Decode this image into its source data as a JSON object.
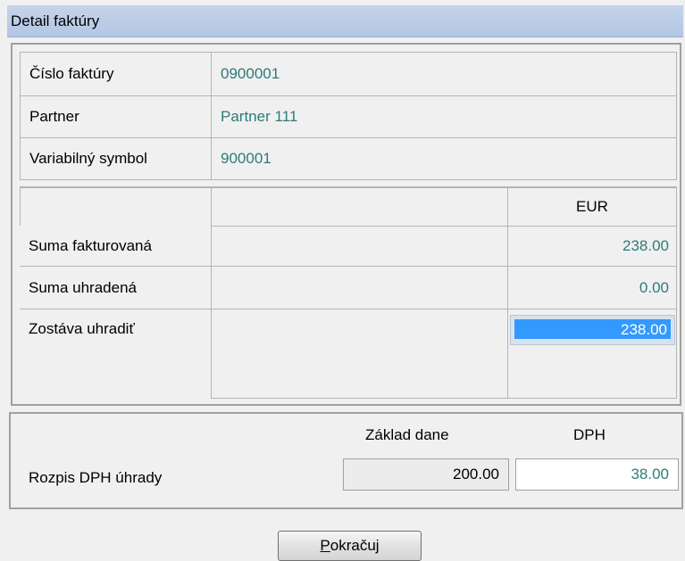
{
  "window": {
    "title": "Detail faktúry"
  },
  "invoice": {
    "rows": [
      {
        "label": "Číslo faktúry",
        "value": "0900001"
      },
      {
        "label": "Partner",
        "value": "Partner 111"
      },
      {
        "label": "Variabilný symbol",
        "value": "900001"
      }
    ]
  },
  "amounts": {
    "currency": "EUR",
    "invoiced_label": "Suma fakturovaná",
    "invoiced_value": "238.00",
    "paid_label": "Suma uhradená",
    "paid_value": "0.00",
    "remaining_label": "Zostáva uhradiť",
    "remaining_value": "238.00"
  },
  "vat": {
    "label": "Rozpis DPH úhrady",
    "base_header": "Základ dane",
    "vat_header": "DPH",
    "base_value": "200.00",
    "vat_value": "38.00"
  },
  "button": {
    "mnemonic": "P",
    "rest": "okračuj"
  },
  "colors": {
    "value_text": "#2e7a7a",
    "selection": "#3399ff"
  }
}
